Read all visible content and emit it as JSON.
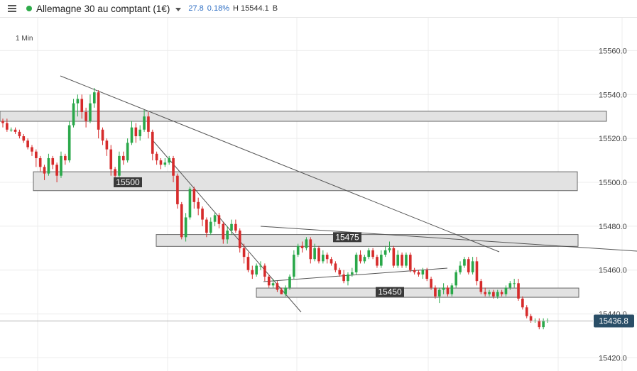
{
  "toolbar": {
    "title": "Allemagne 30 au comptant (1€)",
    "change": "27.8",
    "change_pct": "0.18%",
    "high": "H 15544.1",
    "suffix": "B",
    "change_color": "#2f6fc4"
  },
  "timeframe": "1 Min",
  "chart_data": {
    "type": "candlestick",
    "yticks": [
      "15560.0",
      "15540.0",
      "15520.0",
      "15500.0",
      "15480.0",
      "15460.0",
      "15440.0",
      "15420.0"
    ],
    "ylim": [
      15414,
      15575
    ],
    "last_price": "15436.8",
    "last_price_value": 15436.8,
    "colors": {
      "up": "#2aa84a",
      "down": "#d62b2b",
      "grid": "#ececec",
      "zone_fill": "#e2e2e2",
      "zone_stroke": "#666666",
      "label_bg": "#3a3a3a",
      "price_badge": "#2a4e67"
    },
    "zone_labels": [
      {
        "text": "15500",
        "price": 15500
      },
      {
        "text": "15475",
        "price": 15475
      },
      {
        "text": "15450",
        "price": 15450
      }
    ],
    "zones": [
      {
        "top": 15532.4,
        "bottom": 15527.8
      },
      {
        "top": 15504.8,
        "bottom": 15496.2
      },
      {
        "top": 15476.2,
        "bottom": 15470.8
      },
      {
        "top": 15451.8,
        "bottom": 15447.6
      }
    ],
    "candles": [
      [
        15528,
        15527,
        15529,
        15525
      ],
      [
        15527,
        15524,
        15529,
        15523
      ],
      [
        15524,
        15524,
        15525,
        15523
      ],
      [
        15524,
        15523,
        15525,
        15522
      ],
      [
        15523,
        15521,
        15524,
        15520
      ],
      [
        15521,
        15519,
        15522,
        15518
      ],
      [
        15519,
        15516,
        15520,
        15515
      ],
      [
        15516,
        15514,
        15517,
        15512
      ],
      [
        15514,
        15511,
        15515,
        15507
      ],
      [
        15511,
        15507,
        15512,
        15505
      ],
      [
        15507,
        15504,
        15508,
        15501
      ],
      [
        15504,
        15511,
        15513,
        15503
      ],
      [
        15511,
        15508,
        15512,
        15506
      ],
      [
        15508,
        15503,
        15509,
        15500
      ],
      [
        15503,
        15512,
        15514,
        15502
      ],
      [
        15512,
        15510,
        15513,
        15508
      ],
      [
        15510,
        15526,
        15528,
        15509
      ],
      [
        15526,
        15536,
        15538,
        15525
      ],
      [
        15536,
        15538,
        15540,
        15530
      ],
      [
        15538,
        15532,
        15540,
        15529
      ],
      [
        15532,
        15528,
        15534,
        15525
      ],
      [
        15528,
        15536,
        15540,
        15527
      ],
      [
        15536,
        15541,
        15543,
        15534
      ],
      [
        15541,
        15524,
        15542,
        15520
      ],
      [
        15524,
        15519,
        15525,
        15517
      ],
      [
        15519,
        15515,
        15520,
        15512
      ],
      [
        15515,
        15506,
        15517,
        15503
      ],
      [
        15506,
        15503,
        15507,
        15501
      ],
      [
        15503,
        15512,
        15514,
        15502
      ],
      [
        15512,
        15510,
        15514,
        15508
      ],
      [
        15510,
        15518,
        15520,
        15509
      ],
      [
        15518,
        15525,
        15528,
        15517
      ],
      [
        15525,
        15521,
        15527,
        15518
      ],
      [
        15521,
        15524,
        15526,
        15519
      ],
      [
        15524,
        15530,
        15533,
        15523
      ],
      [
        15530,
        15523,
        15532,
        15520
      ],
      [
        15523,
        15513,
        15524,
        15510
      ],
      [
        15513,
        15510,
        15514,
        15508
      ],
      [
        15510,
        15508,
        15511,
        15506
      ],
      [
        15508,
        15509,
        15511,
        15507
      ],
      [
        15509,
        15511,
        15512,
        15508
      ],
      [
        15511,
        15503,
        15512,
        15500
      ],
      [
        15503,
        15490,
        15504,
        15488
      ],
      [
        15490,
        15475,
        15491,
        15474
      ],
      [
        15475,
        15484,
        15486,
        15473
      ],
      [
        15484,
        15497,
        15498,
        15483
      ],
      [
        15497,
        15491,
        15498,
        15488
      ],
      [
        15491,
        15488,
        15493,
        15485
      ],
      [
        15488,
        15483,
        15489,
        15480
      ],
      [
        15483,
        15477,
        15484,
        15475
      ],
      [
        15477,
        15482,
        15484,
        15476
      ],
      [
        15482,
        15485,
        15486,
        15480
      ],
      [
        15485,
        15481,
        15486,
        15479
      ],
      [
        15481,
        15474,
        15482,
        15472
      ],
      [
        15474,
        15478,
        15480,
        15472
      ],
      [
        15478,
        15481,
        15483,
        15476
      ],
      [
        15481,
        15478,
        15483,
        15477
      ],
      [
        15478,
        15470,
        15479,
        15468
      ],
      [
        15470,
        15466,
        15472,
        15463
      ],
      [
        15466,
        15460,
        15468,
        15459
      ],
      [
        15460,
        15458,
        15462,
        15456
      ],
      [
        15458,
        15462,
        15463,
        15457
      ],
      [
        15462,
        15462,
        15464,
        15460
      ],
      [
        15462,
        15457,
        15463,
        15455
      ],
      [
        15457,
        15453,
        15458,
        15452
      ],
      [
        15453,
        15454,
        15456,
        15452
      ],
      [
        15454,
        15451,
        15455,
        15450
      ],
      [
        15451,
        15449,
        15452,
        15449
      ],
      [
        15449,
        15452,
        15453,
        15448
      ],
      [
        15452,
        15457,
        15458,
        15451
      ],
      [
        15457,
        15467,
        15469,
        15456
      ],
      [
        15467,
        15471,
        15472,
        15466
      ],
      [
        15471,
        15470,
        15473,
        15468
      ],
      [
        15470,
        15474,
        15475,
        15469
      ],
      [
        15474,
        15465,
        15475,
        15463
      ],
      [
        15465,
        15470,
        15472,
        15464
      ],
      [
        15470,
        15464,
        15471,
        15463
      ],
      [
        15464,
        15467,
        15469,
        15463
      ],
      [
        15467,
        15465,
        15468,
        15463
      ],
      [
        15465,
        15463,
        15466,
        15462
      ],
      [
        15463,
        15460,
        15464,
        15459
      ],
      [
        15460,
        15458,
        15461,
        15457
      ],
      [
        15458,
        15455,
        15460,
        15454
      ],
      [
        15455,
        15458,
        15459,
        15453
      ],
      [
        15458,
        15459,
        15461,
        15457
      ],
      [
        15459,
        15467,
        15468,
        15458
      ],
      [
        15467,
        15464,
        15469,
        15463
      ],
      [
        15464,
        15466,
        15467,
        15463
      ],
      [
        15466,
        15469,
        15470,
        15465
      ],
      [
        15469,
        15466,
        15470,
        15465
      ],
      [
        15466,
        15462,
        15467,
        15461
      ],
      [
        15462,
        15467,
        15469,
        15461
      ],
      [
        15467,
        15469,
        15471,
        15466
      ],
      [
        15469,
        15470,
        15473,
        15468
      ],
      [
        15470,
        15462,
        15471,
        15461
      ],
      [
        15462,
        15467,
        15469,
        15461
      ],
      [
        15467,
        15462,
        15468,
        15461
      ],
      [
        15462,
        15467,
        15468,
        15461
      ],
      [
        15467,
        15460,
        15468,
        15459
      ],
      [
        15460,
        15459,
        15461,
        15458
      ],
      [
        15459,
        15458,
        15460,
        15457
      ],
      [
        15458,
        15460,
        15461,
        15456
      ],
      [
        15460,
        15456,
        15461,
        15455
      ],
      [
        15456,
        15452,
        15457,
        15451
      ],
      [
        15452,
        15448,
        15453,
        15447
      ],
      [
        15448,
        15451,
        15452,
        15445
      ],
      [
        15451,
        15452,
        15454,
        15449
      ],
      [
        15452,
        15449,
        15453,
        15448
      ],
      [
        15449,
        15453,
        15454,
        15448
      ],
      [
        15453,
        15459,
        15460,
        15452
      ],
      [
        15459,
        15462,
        15464,
        15458
      ],
      [
        15462,
        15465,
        15466,
        15461
      ],
      [
        15465,
        15459,
        15466,
        15458
      ],
      [
        15459,
        15464,
        15466,
        15458
      ],
      [
        15464,
        15455,
        15466,
        15453
      ],
      [
        15455,
        15450,
        15456,
        15449
      ],
      [
        15450,
        15449,
        15452,
        15448
      ],
      [
        15449,
        15450,
        15451,
        15448
      ],
      [
        15450,
        15448,
        15451,
        15447
      ],
      [
        15448,
        15450,
        15451,
        15447
      ],
      [
        15450,
        15449,
        15451,
        15448
      ],
      [
        15449,
        15452,
        15453,
        15448
      ],
      [
        15452,
        15454,
        15455,
        15451
      ],
      [
        15454,
        15454,
        15456,
        15452
      ],
      [
        15454,
        15447,
        15456,
        15446
      ],
      [
        15447,
        15443,
        15448,
        15442
      ],
      [
        15443,
        15439,
        15444,
        15438
      ],
      [
        15439,
        15437,
        15440,
        15436
      ],
      [
        15437,
        15437,
        15438,
        15436
      ],
      [
        15437,
        15434,
        15438,
        15433
      ],
      [
        15434,
        15437,
        15438,
        15433
      ],
      [
        15437,
        15437,
        15438,
        15436
      ]
    ]
  }
}
